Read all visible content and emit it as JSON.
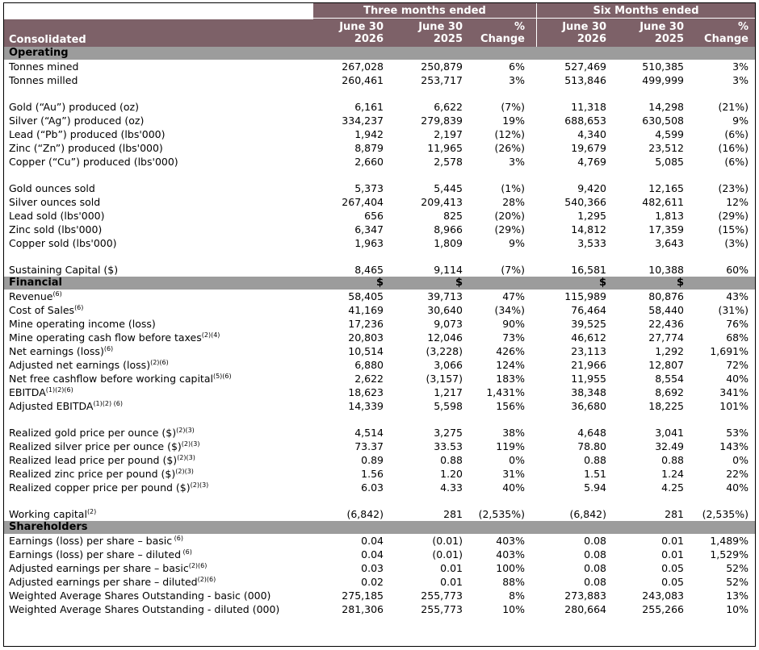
{
  "header": {
    "three_months": "Three months ended",
    "six_months": "Six Months ended",
    "consolidated": "Consolidated",
    "columns": [
      {
        "l1": "June 30",
        "l2": "2026"
      },
      {
        "l1": "June 30",
        "l2": "2025"
      },
      {
        "l1": "%",
        "l2": "Change"
      },
      {
        "l1": "June 30",
        "l2": "2026"
      },
      {
        "l1": "June 30",
        "l2": "2025"
      },
      {
        "l1": "%",
        "l2": "Change"
      }
    ]
  },
  "rows": [
    {
      "type": "section",
      "label": "Operating"
    },
    {
      "type": "data",
      "label": "Tonnes mined",
      "sup": "",
      "values": [
        "267,028",
        "250,879",
        "6%",
        "527,469",
        "510,385",
        "3%"
      ]
    },
    {
      "type": "data",
      "label": "Tonnes milled",
      "sup": "",
      "values": [
        "260,461",
        "253,717",
        "3%",
        "513,846",
        "499,999",
        "3%"
      ]
    },
    {
      "type": "blank"
    },
    {
      "type": "data",
      "label": "Gold (“Au”) produced (oz)",
      "sup": "",
      "values": [
        "6,161",
        "6,622",
        "(7%)",
        "11,318",
        "14,298",
        "(21%)"
      ]
    },
    {
      "type": "data",
      "label": "Silver (“Ag”) produced (oz)",
      "sup": "",
      "values": [
        "334,237",
        "279,839",
        "19%",
        "688,653",
        "630,508",
        "9%"
      ]
    },
    {
      "type": "data",
      "label": "Lead (“Pb”) produced (lbs'000)",
      "sup": "",
      "values": [
        "1,942",
        "2,197",
        "(12%)",
        "4,340",
        "4,599",
        "(6%)"
      ]
    },
    {
      "type": "data",
      "label": "Zinc (“Zn”) produced (lbs'000)",
      "sup": "",
      "values": [
        "8,879",
        "11,965",
        "(26%)",
        "19,679",
        "23,512",
        "(16%)"
      ]
    },
    {
      "type": "data",
      "label": "Copper (“Cu”) produced (lbs'000)",
      "sup": "",
      "values": [
        "2,660",
        "2,578",
        "3%",
        "4,769",
        "5,085",
        "(6%)"
      ]
    },
    {
      "type": "blank"
    },
    {
      "type": "data",
      "label": "Gold ounces sold",
      "sup": "",
      "values": [
        "5,373",
        "5,445",
        "(1%)",
        "9,420",
        "12,165",
        "(23%)"
      ]
    },
    {
      "type": "data",
      "label": "Silver ounces sold",
      "sup": "",
      "values": [
        "267,404",
        "209,413",
        "28%",
        "540,366",
        "482,611",
        "12%"
      ]
    },
    {
      "type": "data",
      "label": "Lead sold (lbs'000)",
      "sup": "",
      "values": [
        "656",
        "825",
        "(20%)",
        "1,295",
        "1,813",
        "(29%)"
      ]
    },
    {
      "type": "data",
      "label": "Zinc sold (lbs'000)",
      "sup": "",
      "values": [
        "6,347",
        "8,966",
        "(29%)",
        "14,812",
        "17,359",
        "(15%)"
      ]
    },
    {
      "type": "data",
      "label": "Copper sold (lbs'000)",
      "sup": "",
      "values": [
        "1,963",
        "1,809",
        "9%",
        "3,533",
        "3,643",
        "(3%)"
      ]
    },
    {
      "type": "blank"
    },
    {
      "type": "data",
      "label": "Sustaining Capital ($)",
      "sup": "",
      "values": [
        "8,465",
        "9,114",
        "(7%)",
        "16,581",
        "10,388",
        "60%"
      ]
    },
    {
      "type": "section",
      "label": "Financial",
      "values": [
        "$",
        "$",
        "",
        "$",
        "$",
        ""
      ]
    },
    {
      "type": "data",
      "label": "Revenue",
      "sup": "(6)",
      "values": [
        "58,405",
        "39,713",
        "47%",
        "115,989",
        "80,876",
        "43%"
      ]
    },
    {
      "type": "data",
      "label": "Cost of Sales",
      "sup": "(6)",
      "values": [
        "41,169",
        "30,640",
        "(34%)",
        "76,464",
        "58,440",
        "(31%)"
      ]
    },
    {
      "type": "data",
      "label": "Mine operating income (loss)",
      "sup": "",
      "values": [
        "17,236",
        "9,073",
        "90%",
        "39,525",
        "22,436",
        "76%"
      ]
    },
    {
      "type": "data",
      "label": "Mine operating cash flow before taxes",
      "sup": "(2)(4)",
      "values": [
        "20,803",
        "12,046",
        "73%",
        "46,612",
        "27,774",
        "68%"
      ]
    },
    {
      "type": "data",
      "label": "Net earnings (loss)",
      "sup": "(6)",
      "values": [
        "10,514",
        "(3,228)",
        "426%",
        "23,113",
        "1,292",
        "1,691%"
      ]
    },
    {
      "type": "data",
      "label": "Adjusted net earnings (loss)",
      "sup": "(2)(6)",
      "values": [
        "6,880",
        "3,066",
        "124%",
        "21,966",
        "12,807",
        "72%"
      ]
    },
    {
      "type": "data",
      "label": "Net free cashflow before working capital",
      "sup": "(5)(6)",
      "values": [
        "2,622",
        "(3,157)",
        "183%",
        "11,955",
        "8,554",
        "40%"
      ]
    },
    {
      "type": "data",
      "label": "EBITDA",
      "sup": "(1)(2)(6)",
      "values": [
        "18,623",
        "1,217",
        "1,431%",
        "38,348",
        "8,692",
        "341%"
      ]
    },
    {
      "type": "data",
      "label": "Adjusted EBITDA",
      "sup": "(1)(2) (6)",
      "values": [
        "14,339",
        "5,598",
        "156%",
        "36,680",
        "18,225",
        "101%"
      ]
    },
    {
      "type": "blank"
    },
    {
      "type": "data",
      "label": "Realized gold price per ounce ($)",
      "sup": "(2)(3)",
      "values": [
        "4,514",
        "3,275",
        "38%",
        "4,648",
        "3,041",
        "53%"
      ]
    },
    {
      "type": "data",
      "label": "Realized silver price per ounce ($)",
      "sup": "(2)(3)",
      "values": [
        "73.37",
        "33.53",
        "119%",
        "78.80",
        "32.49",
        "143%"
      ]
    },
    {
      "type": "data",
      "label": "Realized lead price per pound ($)",
      "sup": "(2)(3)",
      "values": [
        "0.89",
        "0.88",
        "0%",
        "0.88",
        "0.88",
        "0%"
      ]
    },
    {
      "type": "data",
      "label": "Realized zinc price per pound ($)",
      "sup": "(2)(3)",
      "values": [
        "1.56",
        "1.20",
        "31%",
        "1.51",
        "1.24",
        "22%"
      ]
    },
    {
      "type": "data",
      "label": "Realized copper price per pound ($)",
      "sup": "(2)(3)",
      "values": [
        "6.03",
        "4.33",
        "40%",
        "5.94",
        "4.25",
        "40%"
      ]
    },
    {
      "type": "blank"
    },
    {
      "type": "data",
      "label": "Working capital",
      "sup": "(2)",
      "values": [
        "(6,842)",
        "281",
        "(2,535%)",
        "(6,842)",
        "281",
        "(2,535%)"
      ]
    },
    {
      "type": "section",
      "label": "Shareholders"
    },
    {
      "type": "data",
      "label": "Earnings (loss) per share – basic",
      "sup": " (6)",
      "values": [
        "0.04",
        "(0.01)",
        "403%",
        "0.08",
        "0.01",
        "1,489%"
      ]
    },
    {
      "type": "data",
      "label": "Earnings (loss) per share – diluted",
      "sup": " (6)",
      "values": [
        "0.04",
        "(0.01)",
        "403%",
        "0.08",
        "0.01",
        "1,529%"
      ]
    },
    {
      "type": "data",
      "label": "Adjusted earnings per share – basic",
      "sup": "(2)(6)",
      "values": [
        "0.03",
        "0.01",
        "100%",
        "0.08",
        "0.05",
        "52%"
      ]
    },
    {
      "type": "data",
      "label": "Adjusted earnings per share – diluted",
      "sup": "(2)(6)",
      "values": [
        "0.02",
        "0.01",
        "88%",
        "0.08",
        "0.05",
        "52%"
      ]
    },
    {
      "type": "data",
      "label": "Weighted Average Shares Outstanding - basic (000)",
      "sup": "",
      "values": [
        "275,185",
        "255,773",
        "8%",
        "273,883",
        "243,083",
        "13%"
      ]
    },
    {
      "type": "data",
      "label": "Weighted Average Shares Outstanding - diluted (000)",
      "sup": "",
      "values": [
        "281,306",
        "255,773",
        "10%",
        "280,664",
        "255,266",
        "10%"
      ]
    }
  ]
}
